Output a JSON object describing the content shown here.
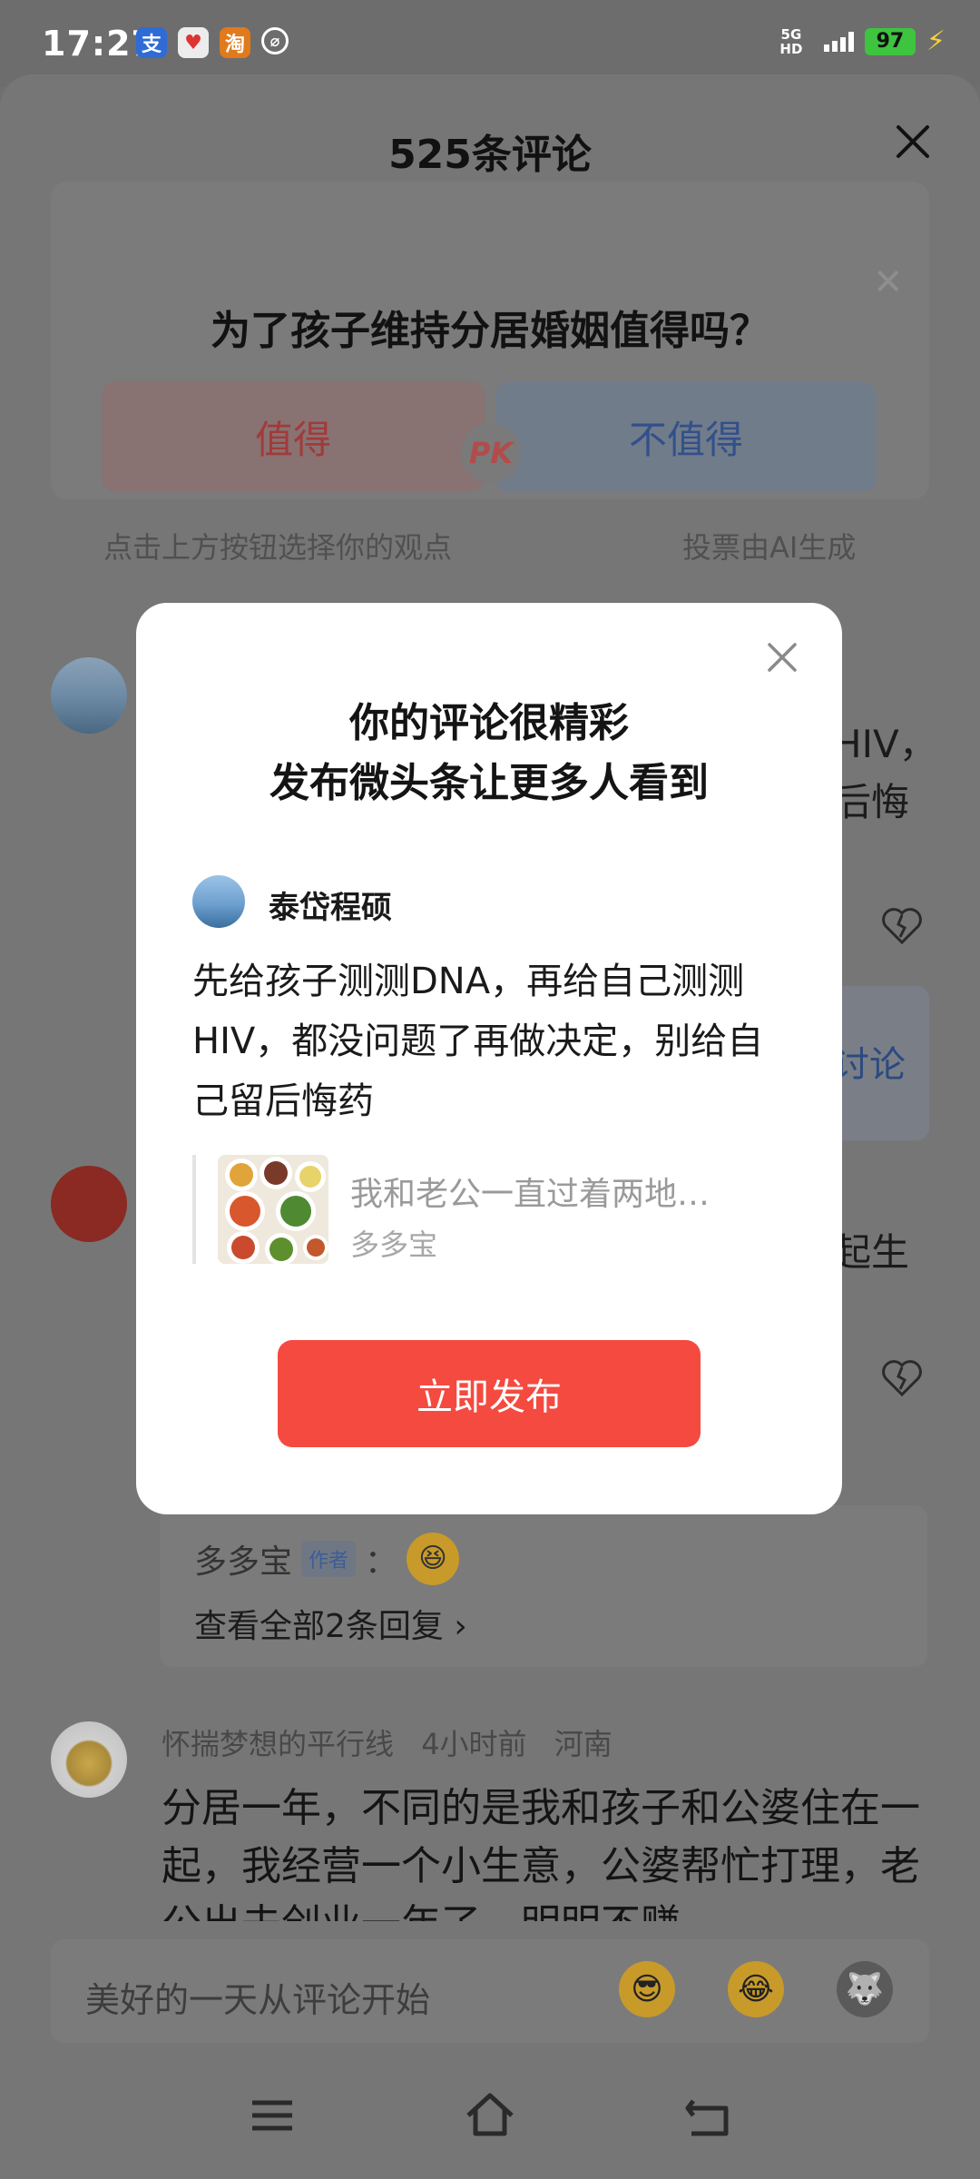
{
  "status_bar": {
    "time": "17:27",
    "apps": [
      {
        "glyph": "支",
        "color": "#2f6bd6"
      },
      {
        "glyph": "♥",
        "color": "#e9e9e9"
      },
      {
        "glyph": "淘",
        "color": "#e07a1c"
      },
      {
        "glyph": "⌀",
        "color": "#6d6d6d"
      }
    ],
    "network": "5G HD",
    "battery": "97"
  },
  "sheet": {
    "title": "525条评论",
    "pk": {
      "question": "为了孩子维持分居婚姻值得吗？",
      "yes": "值得",
      "no": "不值得",
      "vs": "PK",
      "hint_left": "点击上方按钮选择你的观点",
      "hint_right": "投票由AI生成"
    },
    "peek": {
      "c1_line1": "HIV，",
      "c1_line2": "后悔",
      "discuss": "讨论",
      "c2_line1": "起生"
    },
    "reply": {
      "author": "多多宝",
      "tag": "作者",
      "sep": "：",
      "view_all": "查看全部2条回复 ›"
    },
    "comment": {
      "user": "怀揣梦想的平行线",
      "time": "4小时前",
      "region": "河南",
      "text": "分居一年，不同的是我和孩子和公婆住在一起，我经营一个小生意，公婆帮忙打理，老公出去创业一年了，明明不赚"
    },
    "input_placeholder": "美好的一天从评论开始"
  },
  "dialog": {
    "title_line1": "你的评论很精彩",
    "title_line2": "发布微头条让更多人看到",
    "username": "泰岱程硕",
    "body": "先给孩子测测DNA，再给自己测测HIV，都没问题了再做决定，别给自己留后悔药",
    "quote_title": "我和老公一直过着两地…",
    "quote_source": "多多宝",
    "publish": "立即发布"
  }
}
